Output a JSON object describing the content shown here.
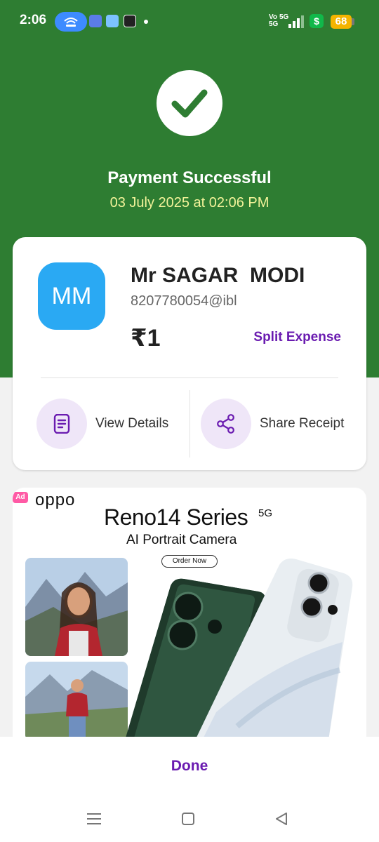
{
  "status_bar": {
    "time": "2:06",
    "network_volte": "Vo 5G",
    "network_5g": "5G",
    "battery": "68"
  },
  "payment": {
    "title": "Payment Successful",
    "datetime": "03 July 2025 at 02:06 PM"
  },
  "recipient": {
    "initials": "MM",
    "name": "Mr SAGAR  MODI",
    "upi_id": "8207780054@ibl",
    "amount": "₹1",
    "split_label": "Split Expense"
  },
  "actions": {
    "view_details": "View Details",
    "share_receipt": "Share Receipt"
  },
  "ad": {
    "badge": "Ad",
    "brand": "oppo",
    "title": "Reno14 Series",
    "title_sup": "5G",
    "subtitle": "AI Portrait Camera",
    "cta": "Order Now"
  },
  "footer": {
    "done_label": "Done"
  },
  "colors": {
    "header_green": "#2e7d32",
    "accent_purple": "#6a1bb0",
    "avatar_blue": "#2aa9f3",
    "date_yellow": "#f3f39a"
  }
}
